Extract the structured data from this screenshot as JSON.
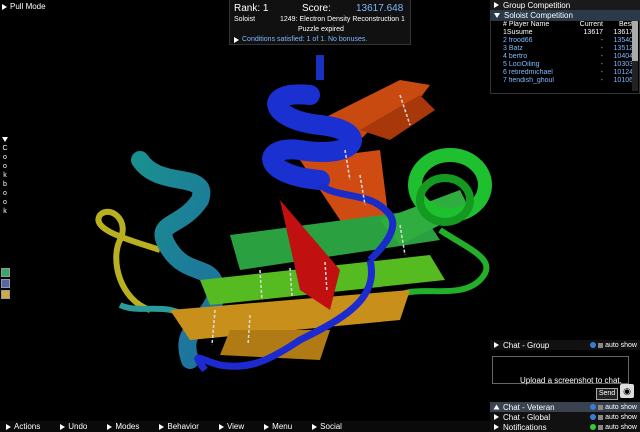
{
  "toolbar": {
    "pull_mode": "Pull Mode"
  },
  "score": {
    "rank_label": "Rank: 1",
    "score_label": "Score:",
    "score_value": "13617.648",
    "mode": "Soloist",
    "puzzle": "1249: Electron Density Reconstruction 1",
    "status": "Puzzle expired",
    "conditions": "Conditions satisfied: 1 of 1. No bonuses."
  },
  "cookbook": {
    "letters": [
      "C",
      "o",
      "o",
      "k",
      "b",
      "o",
      "o",
      "k"
    ]
  },
  "panels": {
    "group": "Group Competition",
    "soloist": "Soloist Competition",
    "headers": {
      "name": "# Player Name",
      "current": "Current",
      "best": "Best"
    },
    "rows": [
      {
        "name": "1Susume",
        "current": "13617",
        "best": "13617"
      },
      {
        "name": "2 frood66",
        "current": "-",
        "best": "13540"
      },
      {
        "name": "3 Batz",
        "current": "-",
        "best": "13512"
      },
      {
        "name": "4 bertro",
        "current": "-",
        "best": "10404"
      },
      {
        "name": "5 LociOiling",
        "current": "-",
        "best": "10303"
      },
      {
        "name": "6 retiredmichael",
        "current": "-",
        "best": "10124"
      },
      {
        "name": "7 fiendish_ghoul",
        "current": "-",
        "best": "10106"
      }
    ]
  },
  "chat": {
    "group": "Chat - Group",
    "auto_show": "auto show",
    "prompt": "Upload a screenshot to chat.",
    "send": "Send",
    "veteran": "Chat - Veteran",
    "global": "Chat - Global",
    "notifications": "Notifications"
  },
  "menu": [
    "Actions",
    "Undo",
    "Modes",
    "Behavior",
    "View",
    "Menu",
    "Social"
  ],
  "colors": {
    "accent": "#7fb8ff",
    "info": "#3a7bd5",
    "green": "#3c3"
  },
  "icons": {
    "screenshot": "camera-icon",
    "info": "info-icon"
  }
}
